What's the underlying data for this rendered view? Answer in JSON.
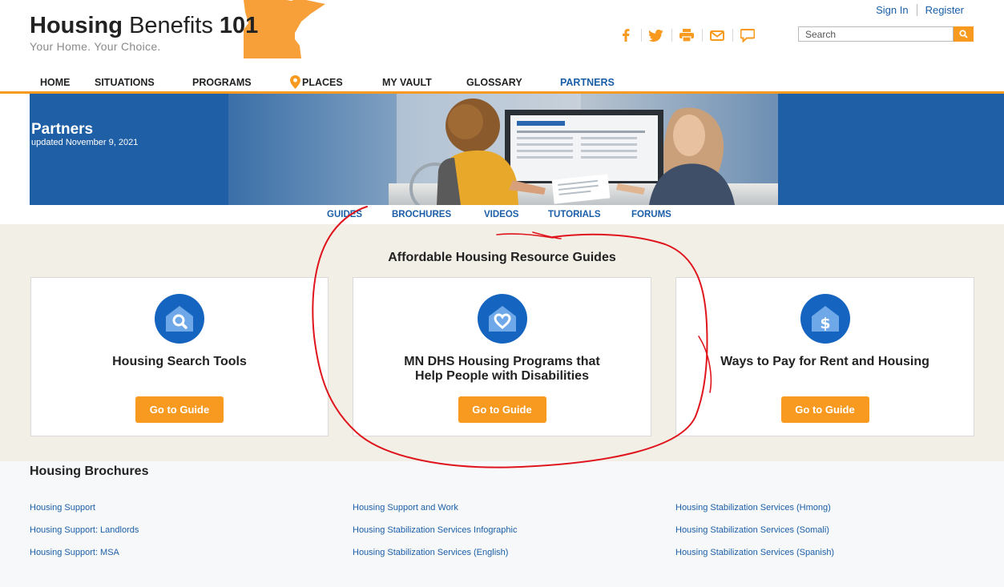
{
  "header": {
    "brand_bold": "Housing",
    "brand_light": "Benefits",
    "brand_num": "101",
    "tagline": "Your Home. Your Choice.",
    "sign_in": "Sign In",
    "register": "Register",
    "search_placeholder": "Search",
    "social_icons": [
      "facebook-icon",
      "twitter-icon",
      "print-icon",
      "email-icon",
      "chat-icon"
    ],
    "search_icon": "search-icon"
  },
  "nav": {
    "items": [
      {
        "label": "HOME"
      },
      {
        "label": "SITUATIONS"
      },
      {
        "label": "PROGRAMS"
      },
      {
        "label": "PLACES"
      },
      {
        "label": "MY VAULT"
      },
      {
        "label": "GLOSSARY"
      },
      {
        "label": "PARTNERS"
      }
    ],
    "active": "PARTNERS"
  },
  "banner": {
    "title": "Partners",
    "updated": "updated November 9, 2021"
  },
  "subnav": {
    "items": [
      {
        "label": "GUIDES"
      },
      {
        "label": "BROCHURES"
      },
      {
        "label": "VIDEOS"
      },
      {
        "label": "TUTORIALS"
      },
      {
        "label": "FORUMS"
      }
    ]
  },
  "guides": {
    "title": "Affordable Housing Resource Guides",
    "cards": [
      {
        "title_line1": "Housing Search Tools",
        "title_line2": "",
        "button": "Go to Guide",
        "icon": "house-search-icon"
      },
      {
        "title_line1": "MN DHS Housing Programs that",
        "title_line2": "Help People with Disabilities",
        "button": "Go to Guide",
        "icon": "house-heart-icon"
      },
      {
        "title_line1": "Ways to Pay for Rent and Housing",
        "title_line2": "",
        "button": "Go to Guide",
        "icon": "house-dollar-icon"
      }
    ]
  },
  "brochures": {
    "title": "Housing Brochures",
    "columns": [
      [
        "Housing Support",
        "Housing Support: Landlords",
        "Housing Support: MSA"
      ],
      [
        "Housing Support and Work",
        "Housing Stabilization Services Infographic",
        "Housing Stabilization Services (English)"
      ],
      [
        "Housing Stabilization Services (Hmong)",
        "Housing Stabilization Services (Somali)",
        "Housing Stabilization Services (Spanish)"
      ]
    ]
  },
  "colors": {
    "accent_orange": "#f79a1f",
    "brand_blue": "#1f5fa6",
    "link_blue": "#1a5ea8",
    "annotation_red": "#e0141c"
  }
}
